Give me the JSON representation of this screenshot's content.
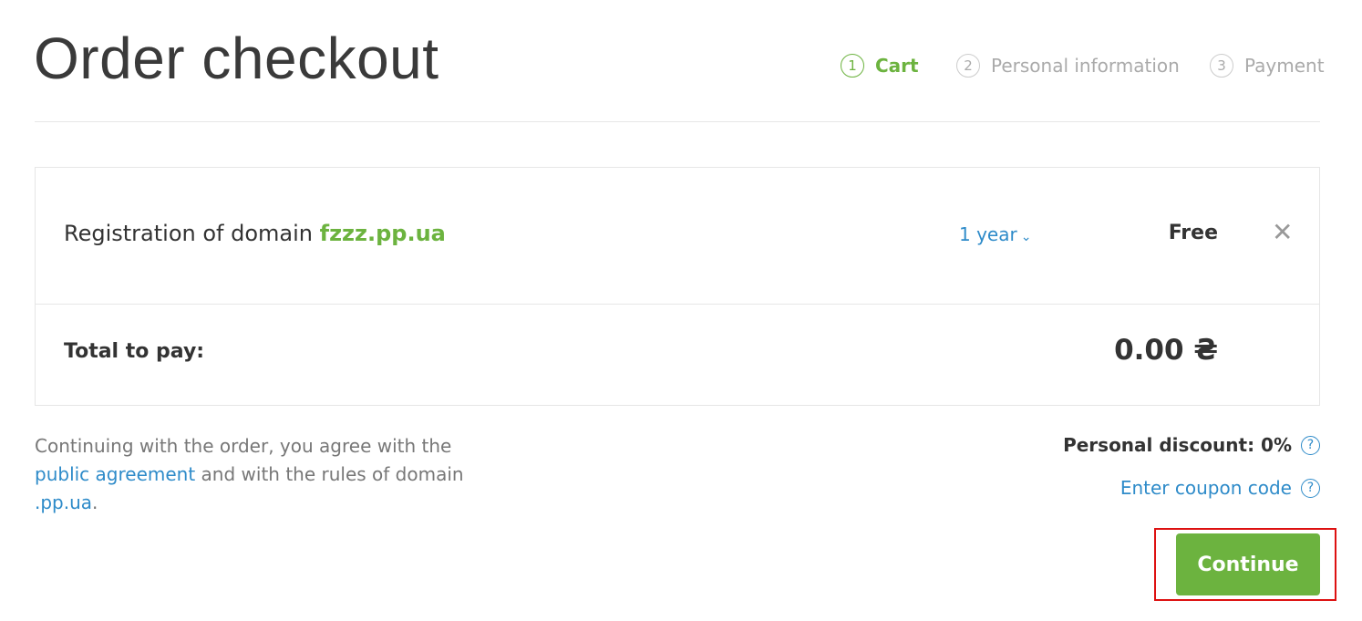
{
  "page": {
    "title": "Order checkout"
  },
  "steps": [
    {
      "number": "1",
      "label": "Cart",
      "active": true
    },
    {
      "number": "2",
      "label": "Personal information",
      "active": false
    },
    {
      "number": "3",
      "label": "Payment",
      "active": false
    }
  ],
  "cart": {
    "item": {
      "prefix": "Registration of domain",
      "domain": "fzzz.pp.ua",
      "period": "1 year",
      "price": "Free",
      "remove_icon": "close-icon"
    },
    "total_label": "Total to pay:",
    "total_value": "0.00 ₴"
  },
  "agreement": {
    "text1": "Continuing with the order, you agree with the",
    "link1": "public agreement",
    "text2": "and with the rules of domain",
    "link2": ".pp.ua",
    "text3": "."
  },
  "discount": {
    "label": "Personal discount: 0%"
  },
  "coupon": {
    "label": "Enter coupon code"
  },
  "actions": {
    "continue_label": "Continue"
  },
  "colors": {
    "accent_green": "#6cb33f",
    "link_blue": "#2e8bc9",
    "highlight_red": "#dd1111"
  }
}
